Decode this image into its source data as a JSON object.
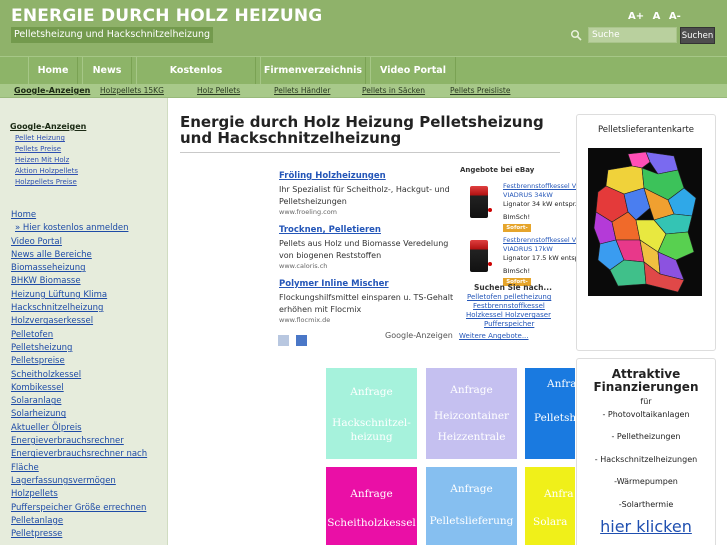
{
  "header": {
    "title": "ENERGIE DURCH HOLZ HEIZUNG",
    "subtitle": "Pelletsheizung und Hackschnitzelheizung",
    "font_tools": [
      "A+",
      "A",
      "A-"
    ],
    "search_placeholder": "Suche",
    "search_button": "Suchen",
    "background_color": "#8fb26a"
  },
  "nav": {
    "items": [
      "Home",
      "News",
      "Kostenlos registrieren",
      "Firmenverzeichnis",
      "Video Portal"
    ]
  },
  "subnav": {
    "label": "Google-Anzeigen",
    "links": [
      "Holzpellets 15KG",
      "Holz Pellets",
      "Pellets Händler",
      "Pellets in Säcken",
      "Pellets Preisliste"
    ]
  },
  "sidebar": {
    "ads_title": "Google-Anzeigen",
    "ads": [
      "Pellet Heizung",
      "Pellets Preise",
      "Heizen Mit Holz",
      "Aktion Holzpellets",
      "Holzpellets Preise"
    ],
    "links": [
      "Home",
      "» Hier kostenlos anmelden",
      "Video Portal",
      "News alle Bereiche",
      "Biomasseheizung",
      "BHKW Biomasse",
      "Heizung Lüftung Klima",
      "Hackschnitzelheizung",
      "Holzvergaserkessel",
      "Pelletofen",
      "Pelletsheizung",
      "Pelletspreise",
      "Scheitholzkessel",
      "Kombikessel",
      "Solaranlage",
      "Solarheizung",
      "Aktueller Ölpreis",
      "Energieverbrauchsrechner",
      "Energieverbrauchsrechner nach",
      "Fläche",
      "Lagerfassungsvermögen",
      "Holzpellets",
      "Pufferspeicher Größe errechnen",
      "Pelletanlage",
      "Pelletpresse"
    ]
  },
  "main": {
    "title": "Energie durch Holz Heizung Pelletsheizung und Hackschnitzelheizung",
    "ads": [
      {
        "title": "Fröling Holzheizungen",
        "text": "Ihr Spezialist für Scheitholz-, Hackgut- und Pelletsheizungen",
        "url": "www.froeling.com"
      },
      {
        "title": "Trocknen, Pelletieren",
        "text": "Pellets aus Holz und Biomasse Veredelung von biogenen Reststoffen",
        "url": "www.caloris.ch"
      },
      {
        "title": "Polymer Inline Mischer",
        "text": "Flockungshilfsmittel einsparen u. TS-Gehalt erhöhen mit Flocmix",
        "url": "www.flocmix.de"
      }
    ],
    "google_ads_label": "Google-Anzeigen",
    "ebay": {
      "title": "Angebote bei eBay",
      "items": [
        {
          "link": "Festbrennstoffkessel V",
          "name": "VIADRUS 34kW",
          "spec1": "Lignator 34 kW entspr.",
          "spec2": "BImSch!",
          "buy": "Sofort-Kaufen"
        },
        {
          "link": "Festbrennstoffkessel V",
          "name": "VIADRUS 17kW",
          "spec1": "Lignator 17.5 kW entsp",
          "spec2": "BImSch!",
          "buy": "Sofort-Kaufen"
        }
      ],
      "search_label": "Suchen Sie nach...",
      "search_links": [
        "Pelletofen pelletheizung",
        "Festbrennstoffkessel",
        "Holzkessel Holzvergaser",
        "Pufferspeicher"
      ],
      "more": "Weitere Angebote..."
    },
    "tiles": [
      {
        "label": "Anfrage",
        "text": "Hackschnitzel-heizung",
        "color": "#a6f2dc"
      },
      {
        "label": "Anfrage",
        "text": "Heizcontainer Heizzentrale",
        "color": "#c5c0f0"
      },
      {
        "label": "Anfrage",
        "text": "Pelletsh",
        "color": "#1a7ae0"
      },
      {
        "label": "Anfrage",
        "text": "Scheitholzkessel",
        "color": "#ea0fa6"
      },
      {
        "label": "Anfrage",
        "text": "Pelletslieferung",
        "color": "#86bff0"
      },
      {
        "label": "Anfra",
        "text": "Solara",
        "color": "#f0f019"
      }
    ]
  },
  "right": {
    "map_title": "Pelletslieferantenkarte",
    "finance_title": "Attraktive Finanzierungen",
    "finance_for": "für",
    "finance_items": [
      "- Photovoltaikanlagen",
      "- Pelletheizungen",
      "- Hackschnitzelheizungen",
      "-Wärmepumpen",
      "-Solarthermie"
    ],
    "finance_link": "hier klicken"
  }
}
